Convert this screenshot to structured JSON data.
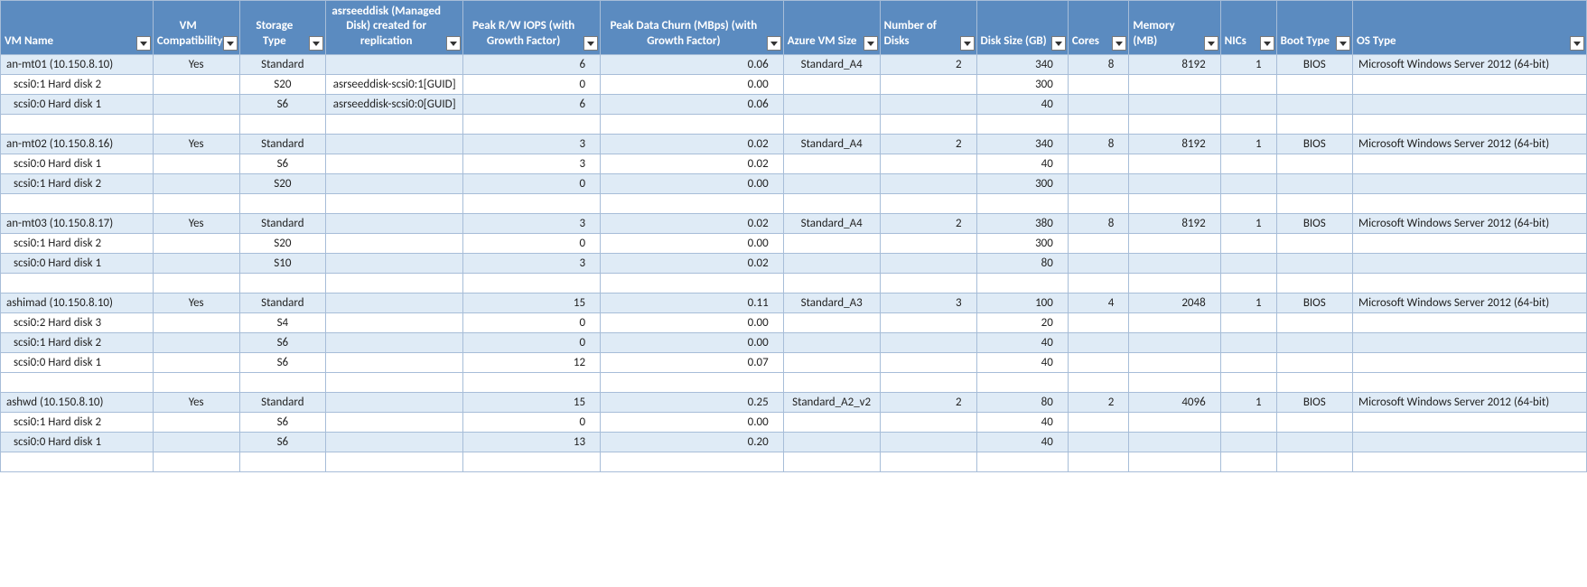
{
  "columns": [
    {
      "key": "vmname",
      "label": "VM Name",
      "cls": "col-vmname",
      "cellcls": "c-vmname",
      "align": "left"
    },
    {
      "key": "compat",
      "label": "VM Compatibility",
      "cls": "col-compat",
      "cellcls": "c-compat",
      "align": "center"
    },
    {
      "key": "storage",
      "label": "Storage Type",
      "cls": "col-storage",
      "cellcls": "c-storage",
      "align": "center"
    },
    {
      "key": "seed",
      "label": "asrseeddisk (Managed Disk) created for replication",
      "cls": "col-seed",
      "cellcls": "c-seed",
      "align": "center"
    },
    {
      "key": "iops",
      "label": "Peak R/W IOPS (with Growth Factor)",
      "cls": "col-iops",
      "cellcls": "c-iops",
      "align": "center"
    },
    {
      "key": "churn",
      "label": "Peak Data Churn (MBps) (with Growth Factor)",
      "cls": "col-churn",
      "cellcls": "c-churn",
      "align": "center"
    },
    {
      "key": "azsize",
      "label": "Azure VM Size",
      "cls": "col-azsize",
      "cellcls": "c-azsize",
      "align": "left"
    },
    {
      "key": "ndisks",
      "label": "Number of Disks",
      "cls": "col-ndisks",
      "cellcls": "c-ndisks",
      "align": "left"
    },
    {
      "key": "dsize",
      "label": "Disk Size (GB)",
      "cls": "col-dsize",
      "cellcls": "c-dsize",
      "align": "left"
    },
    {
      "key": "cores",
      "label": "Cores",
      "cls": "col-cores",
      "cellcls": "c-cores",
      "align": "left"
    },
    {
      "key": "mem",
      "label": "Memory (MB)",
      "cls": "col-mem",
      "cellcls": "c-mem",
      "align": "left"
    },
    {
      "key": "nics",
      "label": "NICs",
      "cls": "col-nics",
      "cellcls": "c-nics",
      "align": "left"
    },
    {
      "key": "boot",
      "label": "Boot Type",
      "cls": "col-boot",
      "cellcls": "c-boot",
      "align": "left"
    },
    {
      "key": "os",
      "label": "OS Type",
      "cls": "col-os",
      "cellcls": "c-os",
      "align": "left"
    }
  ],
  "rows": [
    {
      "kind": "vm",
      "vmname": "an-mt01 (10.150.8.10)",
      "compat": "Yes",
      "storage": "Standard",
      "seed": "",
      "iops": "6",
      "churn": "0.06",
      "azsize": "Standard_A4",
      "ndisks": "2",
      "dsize": "340",
      "cores": "8",
      "mem": "8192",
      "nics": "1",
      "boot": "BIOS",
      "os": "Microsoft Windows Server 2012 (64-bit)"
    },
    {
      "kind": "disk",
      "vmname": "scsi0:1 Hard disk 2",
      "storage": "S20",
      "seed": "asrseeddisk-scsi0:1[GUID]",
      "iops": "0",
      "churn": "0.00",
      "dsize": "300"
    },
    {
      "kind": "disk",
      "vmname": "scsi0:0 Hard disk 1",
      "storage": "S6",
      "seed": "asrseeddisk-scsi0:0[GUID]",
      "iops": "6",
      "churn": "0.06",
      "dsize": "40"
    },
    {
      "kind": "blank"
    },
    {
      "kind": "vm",
      "vmname": "an-mt02 (10.150.8.16)",
      "compat": "Yes",
      "storage": "Standard",
      "seed": "",
      "iops": "3",
      "churn": "0.02",
      "azsize": "Standard_A4",
      "ndisks": "2",
      "dsize": "340",
      "cores": "8",
      "mem": "8192",
      "nics": "1",
      "boot": "BIOS",
      "os": "Microsoft Windows Server 2012 (64-bit)"
    },
    {
      "kind": "disk",
      "vmname": "scsi0:0 Hard disk 1",
      "storage": "S6",
      "seed": "",
      "iops": "3",
      "churn": "0.02",
      "dsize": "40"
    },
    {
      "kind": "disk",
      "vmname": "scsi0:1 Hard disk 2",
      "storage": "S20",
      "seed": "",
      "iops": "0",
      "churn": "0.00",
      "dsize": "300"
    },
    {
      "kind": "blank"
    },
    {
      "kind": "vm",
      "vmname": "an-mt03 (10.150.8.17)",
      "compat": "Yes",
      "storage": "Standard",
      "seed": "",
      "iops": "3",
      "churn": "0.02",
      "azsize": "Standard_A4",
      "ndisks": "2",
      "dsize": "380",
      "cores": "8",
      "mem": "8192",
      "nics": "1",
      "boot": "BIOS",
      "os": "Microsoft Windows Server 2012 (64-bit)"
    },
    {
      "kind": "disk",
      "vmname": "scsi0:1 Hard disk 2",
      "storage": "S20",
      "seed": "",
      "iops": "0",
      "churn": "0.00",
      "dsize": "300"
    },
    {
      "kind": "disk",
      "vmname": "scsi0:0 Hard disk 1",
      "storage": "S10",
      "seed": "",
      "iops": "3",
      "churn": "0.02",
      "dsize": "80"
    },
    {
      "kind": "blank"
    },
    {
      "kind": "vm",
      "vmname": "ashimad (10.150.8.10)",
      "compat": "Yes",
      "storage": "Standard",
      "seed": "",
      "iops": "15",
      "churn": "0.11",
      "azsize": "Standard_A3",
      "ndisks": "3",
      "dsize": "100",
      "cores": "4",
      "mem": "2048",
      "nics": "1",
      "boot": "BIOS",
      "os": "Microsoft Windows Server 2012 (64-bit)"
    },
    {
      "kind": "disk",
      "vmname": "scsi0:2 Hard disk 3",
      "storage": "S4",
      "seed": "",
      "iops": "0",
      "churn": "0.00",
      "dsize": "20"
    },
    {
      "kind": "disk",
      "vmname": "scsi0:1 Hard disk 2",
      "storage": "S6",
      "seed": "",
      "iops": "0",
      "churn": "0.00",
      "dsize": "40"
    },
    {
      "kind": "disk",
      "vmname": "scsi0:0 Hard disk 1",
      "storage": "S6",
      "seed": "",
      "iops": "12",
      "churn": "0.07",
      "dsize": "40"
    },
    {
      "kind": "blank"
    },
    {
      "kind": "vm",
      "vmname": "ashwd (10.150.8.10)",
      "compat": "Yes",
      "storage": "Standard",
      "seed": "",
      "iops": "15",
      "churn": "0.25",
      "azsize": "Standard_A2_v2",
      "ndisks": "2",
      "dsize": "80",
      "cores": "2",
      "mem": "4096",
      "nics": "1",
      "boot": "BIOS",
      "os": "Microsoft Windows Server 2012 (64-bit)"
    },
    {
      "kind": "disk",
      "vmname": "scsi0:1 Hard disk 2",
      "storage": "S6",
      "seed": "",
      "iops": "0",
      "churn": "0.00",
      "dsize": "40"
    },
    {
      "kind": "disk",
      "vmname": "scsi0:0 Hard disk 1",
      "storage": "S6",
      "seed": "",
      "iops": "13",
      "churn": "0.20",
      "dsize": "40"
    },
    {
      "kind": "blank"
    }
  ]
}
